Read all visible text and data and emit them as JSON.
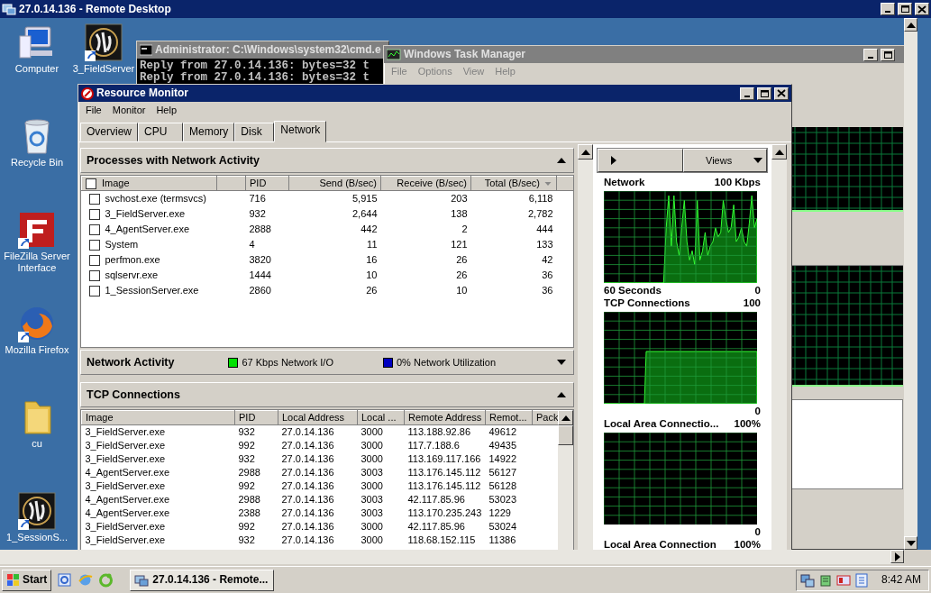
{
  "remote_desktop": {
    "title": "27.0.14.136 - Remote Desktop"
  },
  "desktop_icons": [
    {
      "label": "Computer",
      "kind": "computer"
    },
    {
      "label": "Recycle Bin",
      "kind": "recycle-bin"
    },
    {
      "label": "FileZilla Server Interface",
      "kind": "filezilla"
    },
    {
      "label": "Mozilla Firefox",
      "kind": "firefox"
    },
    {
      "label": "cu",
      "kind": "folder"
    },
    {
      "label": "1_SessionS...",
      "kind": "app"
    },
    {
      "label": "3_FieldServer",
      "kind": "app"
    }
  ],
  "cmd_window": {
    "title": "Administrator: C:\\Windows\\system32\\cmd.e",
    "lines": [
      "Reply from 27.0.14.136: bytes=32 t",
      "Reply from 27.0.14.136: bytes=32 t"
    ]
  },
  "task_manager": {
    "title": "Windows Task Manager",
    "menu": [
      "File",
      "Options",
      "View",
      "Help"
    ]
  },
  "resource_monitor": {
    "title": "Resource Monitor",
    "menu": [
      "File",
      "Monitor",
      "Help"
    ],
    "tabs": [
      {
        "label": "Overview",
        "selected": false
      },
      {
        "label": "CPU",
        "selected": false
      },
      {
        "label": "Memory",
        "selected": false
      },
      {
        "label": "Disk",
        "selected": false
      },
      {
        "label": "Network",
        "selected": true
      }
    ],
    "processes": {
      "title": "Processes with Network Activity",
      "expanded": true,
      "all_checked": false,
      "columns": [
        {
          "label": "Image",
          "sorted": false
        },
        {
          "label": "PID",
          "sorted": false
        },
        {
          "label": "Send (B/sec)",
          "sorted": false
        },
        {
          "label": "Receive (B/sec)",
          "sorted": false
        },
        {
          "label": "Total (B/sec)",
          "sorted": true
        }
      ],
      "rows": [
        {
          "checked": false,
          "cells": [
            "svchost.exe (termsvcs)",
            "716",
            "5,915",
            "203",
            "6,118"
          ]
        },
        {
          "checked": false,
          "cells": [
            "3_FieldServer.exe",
            "932",
            "2,644",
            "138",
            "2,782"
          ]
        },
        {
          "checked": false,
          "cells": [
            "4_AgentServer.exe",
            "2888",
            "442",
            "2",
            "444"
          ]
        },
        {
          "checked": false,
          "cells": [
            "System",
            "4",
            "11",
            "121",
            "133"
          ]
        },
        {
          "checked": false,
          "cells": [
            "perfmon.exe",
            "3820",
            "16",
            "26",
            "42"
          ]
        },
        {
          "checked": false,
          "cells": [
            "sqlservr.exe",
            "1444",
            "10",
            "26",
            "36"
          ]
        },
        {
          "checked": false,
          "cells": [
            "1_SessionServer.exe",
            "2860",
            "26",
            "10",
            "36"
          ]
        }
      ]
    },
    "network_activity": {
      "title": "Network Activity",
      "expanded": false,
      "legend": [
        {
          "label": "67 Kbps Network I/O",
          "color": "#00e000"
        },
        {
          "label": "0% Network Utilization",
          "color": "#0000c0"
        }
      ]
    },
    "tcp_connections": {
      "title": "TCP Connections",
      "expanded": true,
      "columns": [
        "Image",
        "PID",
        "Local Address",
        "Local ...",
        "Remote Address",
        "Remot...",
        "Pack"
      ],
      "rows": [
        [
          "3_FieldServer.exe",
          "932",
          "27.0.14.136",
          "3000",
          "113.188.92.86",
          "49612"
        ],
        [
          "3_FieldServer.exe",
          "992",
          "27.0.14.136",
          "3000",
          "117.7.188.6",
          "49435"
        ],
        [
          "3_FieldServer.exe",
          "932",
          "27.0.14.136",
          "3000",
          "113.169.117.166",
          "14922"
        ],
        [
          "4_AgentServer.exe",
          "2988",
          "27.0.14.136",
          "3003",
          "113.176.145.112",
          "56127"
        ],
        [
          "3_FieldServer.exe",
          "992",
          "27.0.14.136",
          "3000",
          "113.176.145.112",
          "56128"
        ],
        [
          "4_AgentServer.exe",
          "2988",
          "27.0.14.136",
          "3003",
          "42.117.85.96",
          "53023"
        ],
        [
          "4_AgentServer.exe",
          "2388",
          "27.0.14.136",
          "3003",
          "113.170.235.243",
          "1229"
        ],
        [
          "3_FieldServer.exe",
          "992",
          "27.0.14.136",
          "3000",
          "42.117.85.96",
          "53024"
        ],
        [
          "3_FieldServer.exe",
          "932",
          "27.0.14.136",
          "3000",
          "118.68.152.115",
          "11386"
        ]
      ]
    },
    "graph_panel": {
      "views_label": "Views",
      "graphs": [
        {
          "title": "Network",
          "max": "100 Kbps",
          "kind": "network",
          "time": "60 Seconds",
          "min": "0"
        },
        {
          "title": "TCP Connections",
          "max": "100",
          "kind": "tcp",
          "min": "0"
        },
        {
          "title": "Local Area Connectio...",
          "max": "100%",
          "kind": "empty",
          "min": "0"
        },
        {
          "title": "Local Area Connection",
          "max": "100%"
        }
      ]
    }
  },
  "taskbar": {
    "start": "Start",
    "tasks": [
      "27.0.14.136 - Remote..."
    ],
    "clock": "8:42 AM"
  }
}
